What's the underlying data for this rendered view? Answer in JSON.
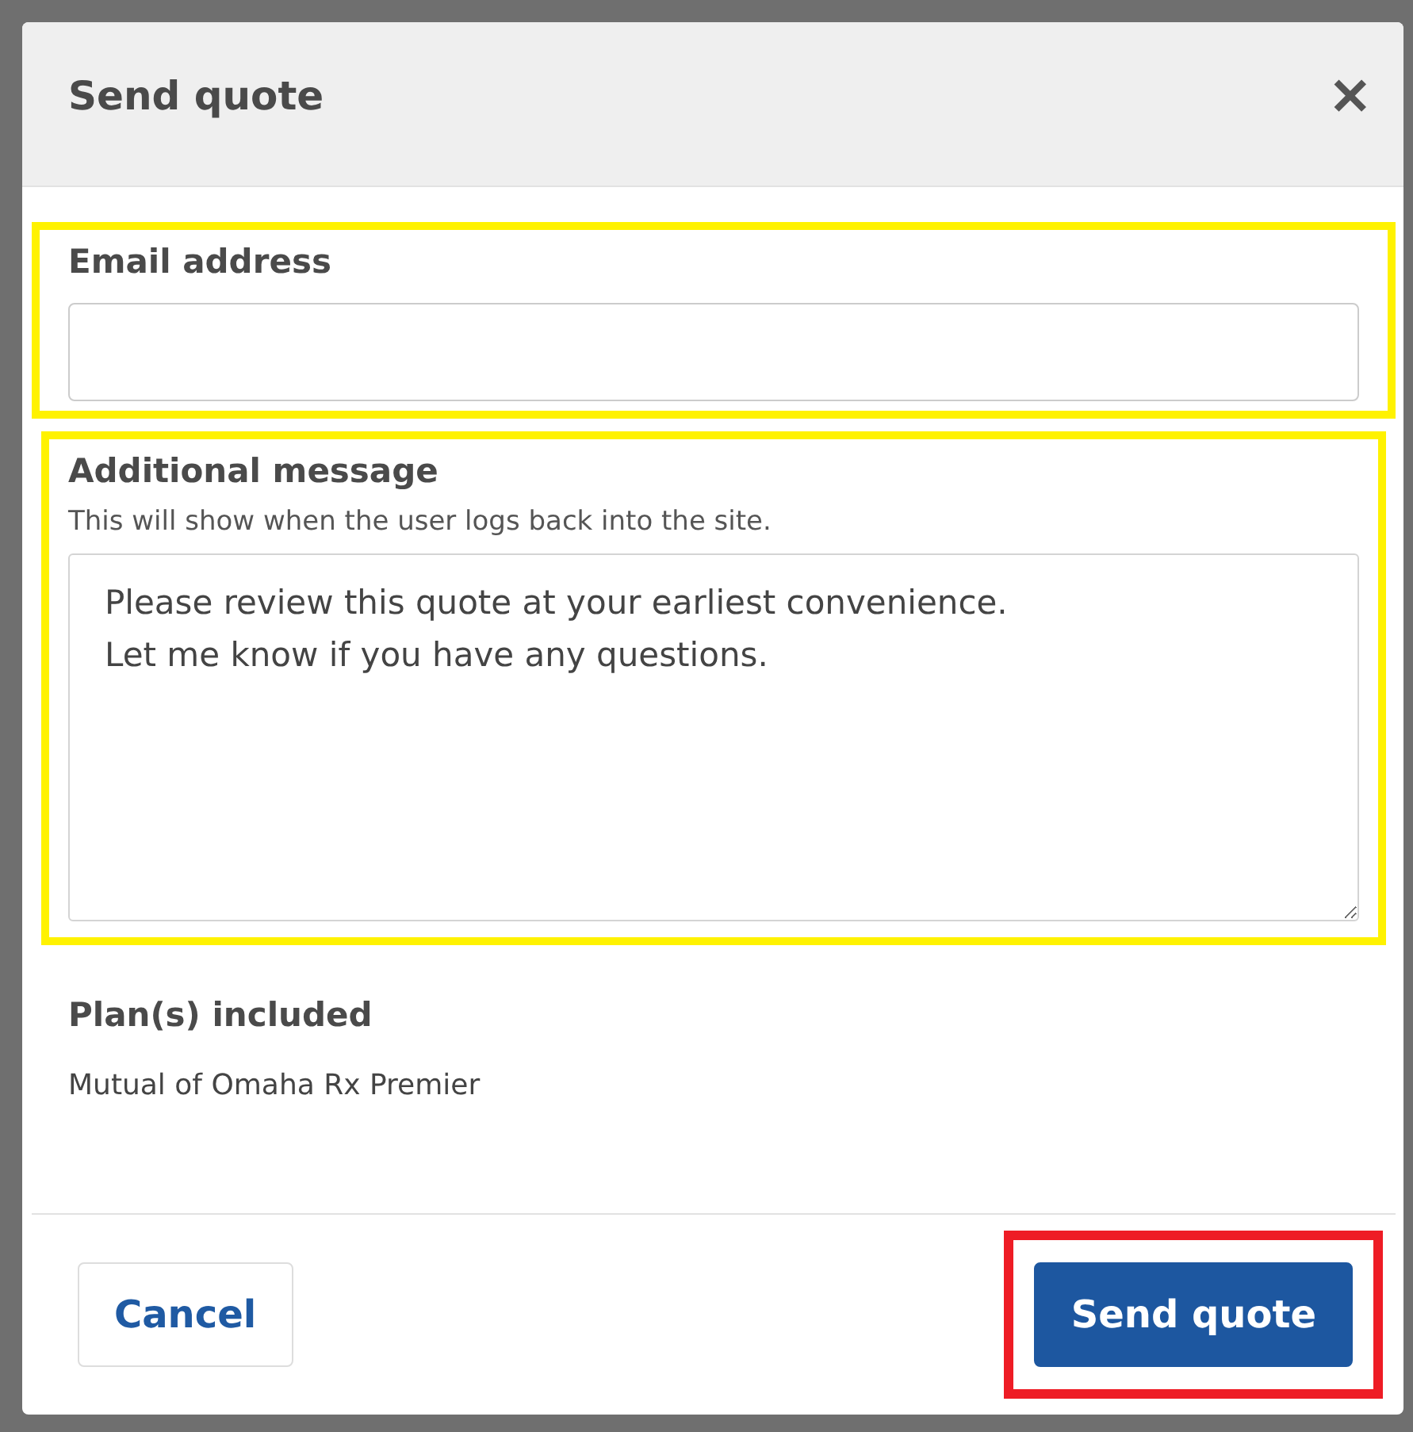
{
  "dialog": {
    "title": "Send quote",
    "close_label": "✕"
  },
  "email": {
    "label": "Email address",
    "highlighted": true
  },
  "message": {
    "label": "Additional message",
    "help": "This will show when the user logs back into the site.",
    "value": "Please review this quote at your earliest convenience.\nLet me know if you have any questions.",
    "highlighted": true
  },
  "plans": {
    "label": "Plan(s) included",
    "items": [
      "Mutual of Omaha Rx Premier"
    ]
  },
  "buttons": [
    {
      "label": "Cancel",
      "kind": "secondary",
      "highlighted": false
    },
    {
      "label": "Send quote",
      "kind": "primary",
      "highlighted": true
    }
  ]
}
